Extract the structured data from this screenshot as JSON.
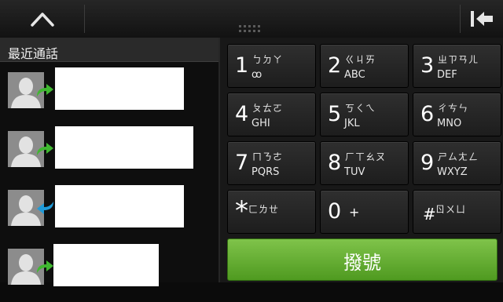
{
  "topbar": {
    "up_icon": "chevron-up-icon",
    "back_icon": "backspace-icon"
  },
  "call_log": {
    "title": "最近通話",
    "entries": [
      {
        "call_type": "outgoing",
        "arrow_color": "#3fb830"
      },
      {
        "call_type": "outgoing",
        "arrow_color": "#3fb830"
      },
      {
        "call_type": "incoming",
        "arrow_color": "#1f9ad8"
      },
      {
        "call_type": "outgoing",
        "arrow_color": "#3fb830"
      }
    ]
  },
  "dialpad": {
    "keys": [
      {
        "digit": "1",
        "zhuyin": "ㄅㄉㄚ",
        "latin": "ꝏ"
      },
      {
        "digit": "2",
        "zhuyin": "ㄍㄐㄞ",
        "latin": "ABC"
      },
      {
        "digit": "3",
        "zhuyin": "ㄓㄗㄢㄦ",
        "latin": "DEF"
      },
      {
        "digit": "4",
        "zhuyin": "ㄆㄊㄛ",
        "latin": "GHI"
      },
      {
        "digit": "5",
        "zhuyin": "ㄎㄑㄟ",
        "latin": "JKL"
      },
      {
        "digit": "6",
        "zhuyin": "ㄔㄘㄣ",
        "latin": "MNO"
      },
      {
        "digit": "7",
        "zhuyin": "ㄇㄋㄜ",
        "latin": "PQRS"
      },
      {
        "digit": "8",
        "zhuyin": "ㄏㄒㄠㄡ",
        "latin": "TUV"
      },
      {
        "digit": "9",
        "zhuyin": "ㄕㄙㄤㄥ",
        "latin": "WXYZ"
      },
      {
        "digit": "*",
        "zhuyin": "ㄈㄌㄝ",
        "latin": ""
      },
      {
        "digit": "0",
        "zhuyin": "",
        "latin": "+"
      },
      {
        "digit": "#",
        "zhuyin": "ㄖㄨㄩ",
        "latin": ""
      }
    ],
    "call_label": "撥號",
    "call_color": "#5fa82c"
  }
}
